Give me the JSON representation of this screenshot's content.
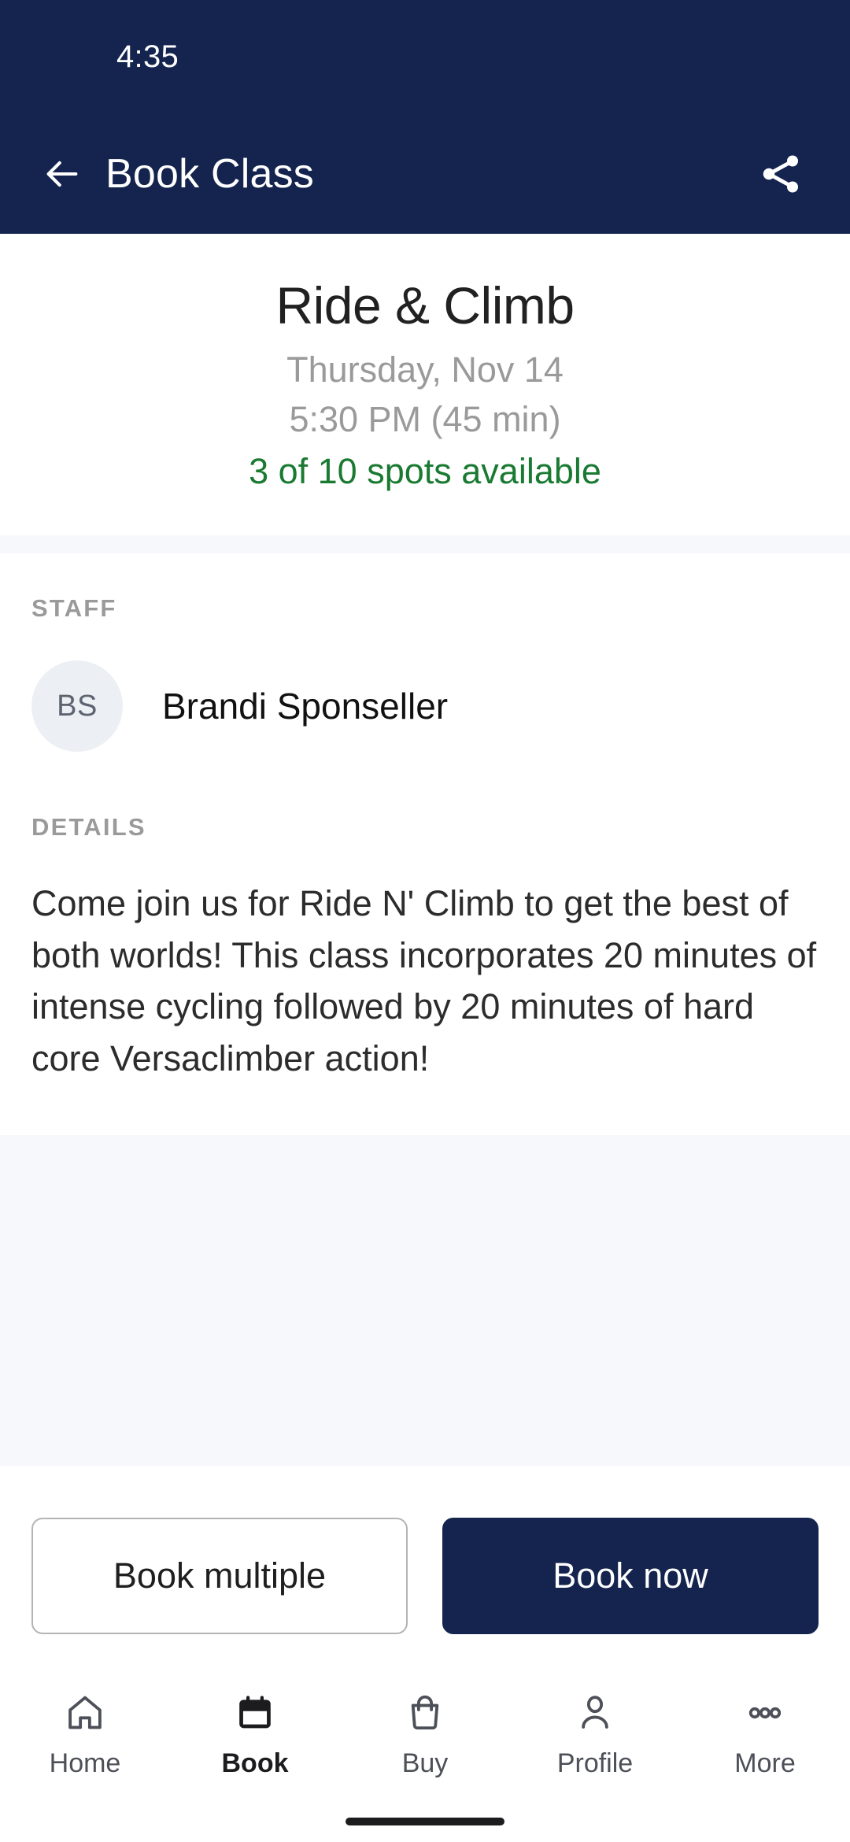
{
  "status_bar": {
    "time": "4:35"
  },
  "app_bar": {
    "title": "Book Class",
    "back_icon": "arrow-left-icon",
    "share_icon": "share-icon"
  },
  "hero": {
    "class_title": "Ride & Climb",
    "date": "Thursday, Nov 14",
    "time": "5:30 PM (45 min)",
    "spots": "3 of 10 spots available",
    "spots_color": "#1a7a32"
  },
  "staff": {
    "label": "STAFF",
    "initials": "BS",
    "name": "Brandi Sponseller"
  },
  "details": {
    "label": "DETAILS",
    "body": "Come join us for Ride N' Climb to get the best of both worlds! This class incorporates 20 minutes of intense cycling followed by 20 minutes of hard core Versaclimber action!"
  },
  "actions": {
    "book_multiple": "Book multiple",
    "book_now": "Book now",
    "primary_color": "#14244e"
  },
  "bottom_nav": {
    "items": [
      {
        "label": "Home",
        "icon": "home-icon",
        "active": false
      },
      {
        "label": "Book",
        "icon": "calendar-icon",
        "active": true
      },
      {
        "label": "Buy",
        "icon": "bag-icon",
        "active": false
      },
      {
        "label": "Profile",
        "icon": "person-icon",
        "active": false
      },
      {
        "label": "More",
        "icon": "ellipsis-icon",
        "active": false
      }
    ]
  },
  "theme": {
    "navy": "#14244e",
    "band": "#f6f8fb",
    "muted": "#9a9a9a"
  }
}
